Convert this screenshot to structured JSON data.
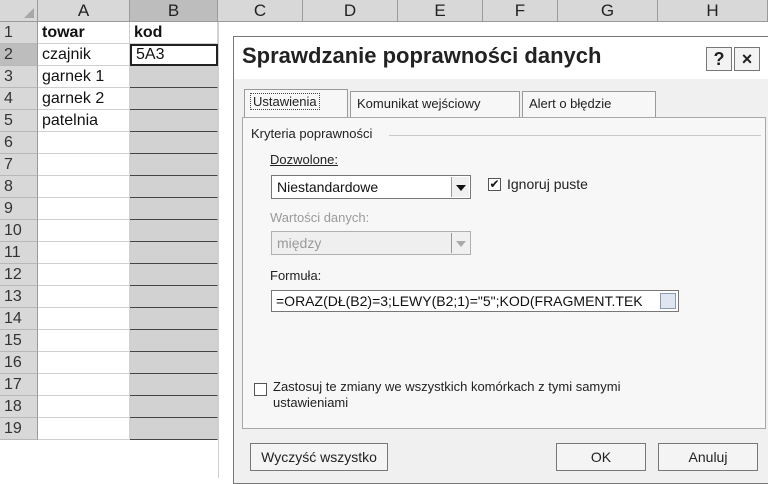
{
  "sheet": {
    "columns": [
      "A",
      "B",
      "C",
      "D",
      "E",
      "F",
      "G",
      "H"
    ],
    "rows": [
      "1",
      "2",
      "3",
      "4",
      "5",
      "6",
      "7",
      "8",
      "9",
      "10",
      "11",
      "12",
      "13",
      "14",
      "15",
      "16",
      "17",
      "18",
      "19"
    ],
    "colA": [
      "towar",
      "czajnik",
      "garnek 1",
      "garnek 2",
      "patelnia"
    ],
    "colB": [
      "kod",
      "5A3"
    ]
  },
  "dialog": {
    "title": "Sprawdzanie poprawności danych",
    "help_label": "?",
    "close_label": "×",
    "tabs": [
      {
        "label": "Ustawienia"
      },
      {
        "label": "Komunikat wejściowy"
      },
      {
        "label": "Alert o błędzie"
      }
    ],
    "criteria_label": "Kryteria poprawności",
    "allowed_label": "Dozwolone:",
    "allowed_value": "Niestandardowe",
    "ignore_blank_label": "Ignoruj puste",
    "ignore_blank_checked": true,
    "data_values_label": "Wartości danych:",
    "data_values_value": "między",
    "formula_label": "Formuła:",
    "formula_value": "=ORAZ(DŁ(B2)=3;LEWY(B2;1)=\"5\";KOD(FRAGMENT.TEK",
    "apply_label_line1": "Zastosuj te zmiany we wszystkich komórkach z tymi samymi",
    "apply_label_line2": "ustawieniami",
    "apply_checked": false,
    "clear_all_label": "Wyczyść wszystko",
    "ok_label": "OK",
    "cancel_label": "Anuluj"
  }
}
